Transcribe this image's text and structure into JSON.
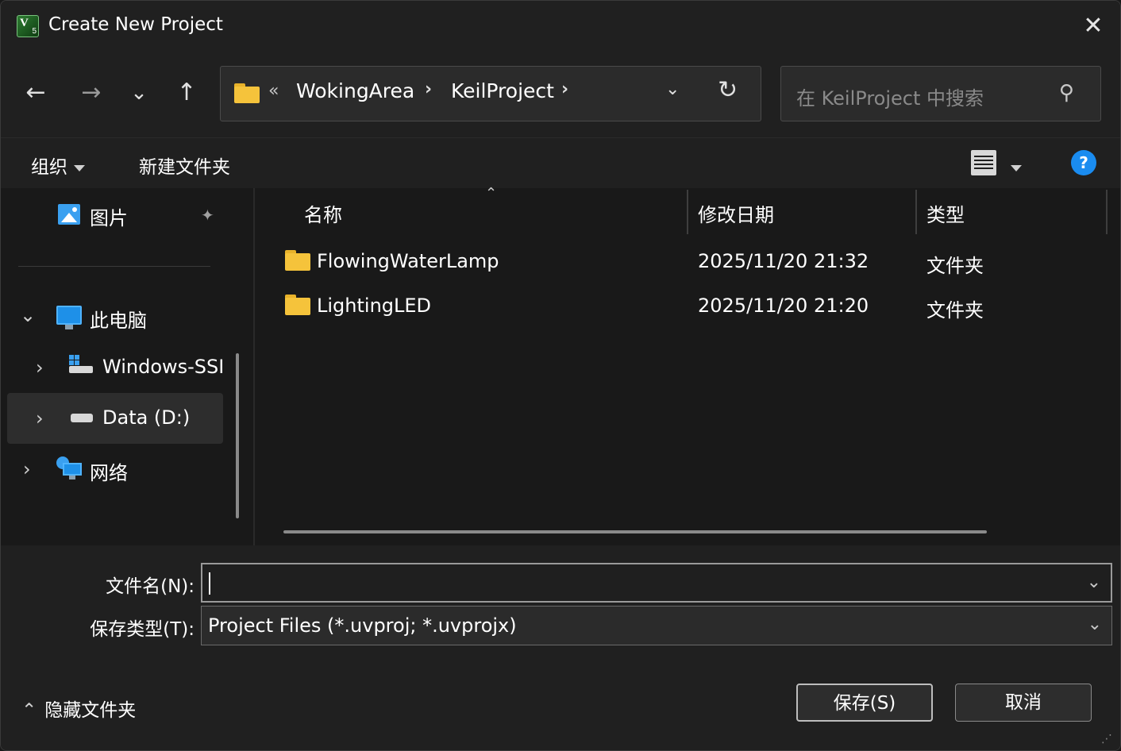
{
  "window": {
    "title": "Create New Project",
    "close_glyph": "✕"
  },
  "nav": {
    "back": "←",
    "forward": "→",
    "recent": "⌄",
    "up": "↑",
    "breadcrumb_overflow": "«",
    "breadcrumbs": [
      "WokingArea",
      "KeilProject"
    ],
    "separator": "›",
    "dropdown": "⌄",
    "refresh": "↻"
  },
  "search": {
    "placeholder": "在 KeilProject 中搜索",
    "icon": "⚲"
  },
  "toolbar": {
    "organize": "组织",
    "new_folder": "新建文件夹",
    "help": "?"
  },
  "tree": {
    "pinned": {
      "label": "图片",
      "icon": "pictures-icon",
      "pin": "📌"
    },
    "this_pc": {
      "label": "此电脑",
      "expanded": true
    },
    "drives": [
      {
        "label": "Windows-SSI",
        "icon": "system-drive-icon"
      },
      {
        "label": "Data (D:)",
        "icon": "drive-icon",
        "selected": true
      }
    ],
    "network": {
      "label": "网络"
    },
    "expand_glyph": "›",
    "collapse_glyph": "⌄"
  },
  "columns": {
    "name": "名称",
    "modified": "修改日期",
    "type": "类型",
    "sort_glyph": "⌃"
  },
  "files": [
    {
      "name": "FlowingWaterLamp",
      "modified": "2025/11/20 21:32",
      "type": "文件夹"
    },
    {
      "name": "LightingLED",
      "modified": "2025/11/20 21:20",
      "type": "文件夹"
    }
  ],
  "form": {
    "filename_label": "文件名(N):",
    "filename_value": "",
    "filetype_label": "保存类型(T):",
    "filetype_value": "Project Files (*.uvproj; *.uvprojx)",
    "caret": "⌄"
  },
  "footer": {
    "hide_folders": "隐藏文件夹",
    "hide_glyph": "⌃",
    "save": "保存(S)",
    "cancel": "取消"
  },
  "colors": {
    "accent": "#1a8cf0",
    "folder": "#f5c33b",
    "background": "#191919"
  }
}
